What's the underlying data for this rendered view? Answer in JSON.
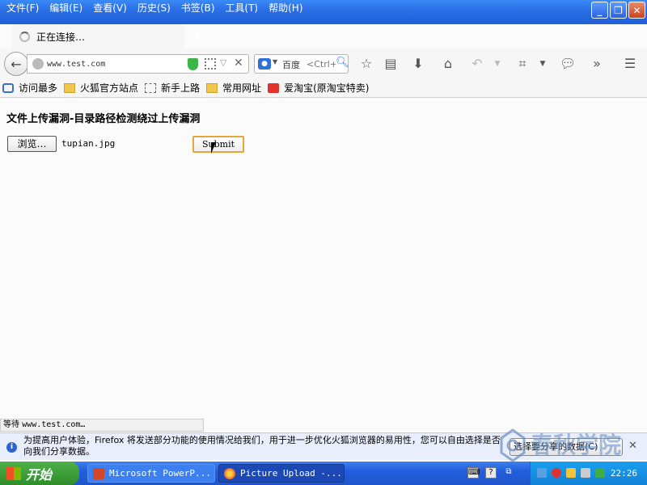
{
  "menu": [
    "文件(F)",
    "编辑(E)",
    "查看(V)",
    "历史(S)",
    "书签(B)",
    "工具(T)",
    "帮助(H)"
  ],
  "tab": {
    "title": "正在连接…",
    "new_tab": "+"
  },
  "urlbar": {
    "value": "www.test.com"
  },
  "searchbar": {
    "engine": "百度",
    "placeholder": "<Ctrl+K>"
  },
  "bookmarks": [
    {
      "label": "访问最多",
      "icon": "search-icon"
    },
    {
      "label": "火狐官方站点",
      "icon": "folder-icon"
    },
    {
      "label": "新手上路",
      "icon": "blank-page-icon"
    },
    {
      "label": "常用网址",
      "icon": "folder-icon"
    },
    {
      "label": "爱淘宝(原淘宝特卖)",
      "icon": "taobao-icon"
    }
  ],
  "page": {
    "heading": "文件上传漏洞-目录路径检测绕过上传漏洞",
    "browse_label": "浏览…",
    "file_name": "tupian.jpg",
    "submit_label": "Submit"
  },
  "status": {
    "prefix": "等待",
    "host": "www.test.com…"
  },
  "notification": {
    "message": "为提高用户体验，Firefox 将发送部分功能的使用情况给我们，用于进一步优化火狐浏览器的易用性，您可以自由选择是否向我们分享数据。",
    "choose_label": "选择要分享的数据(C)",
    "watermark": "春秋学院"
  },
  "taskbar": {
    "start_label": "开始",
    "tasks": [
      "Microsoft PowerP...",
      "Picture Upload -..."
    ],
    "clock": "22:26"
  },
  "colors": {
    "xp_blue": "#2b6fe6",
    "start_green": "#3a9b35",
    "submit_border": "#e8a63a"
  }
}
